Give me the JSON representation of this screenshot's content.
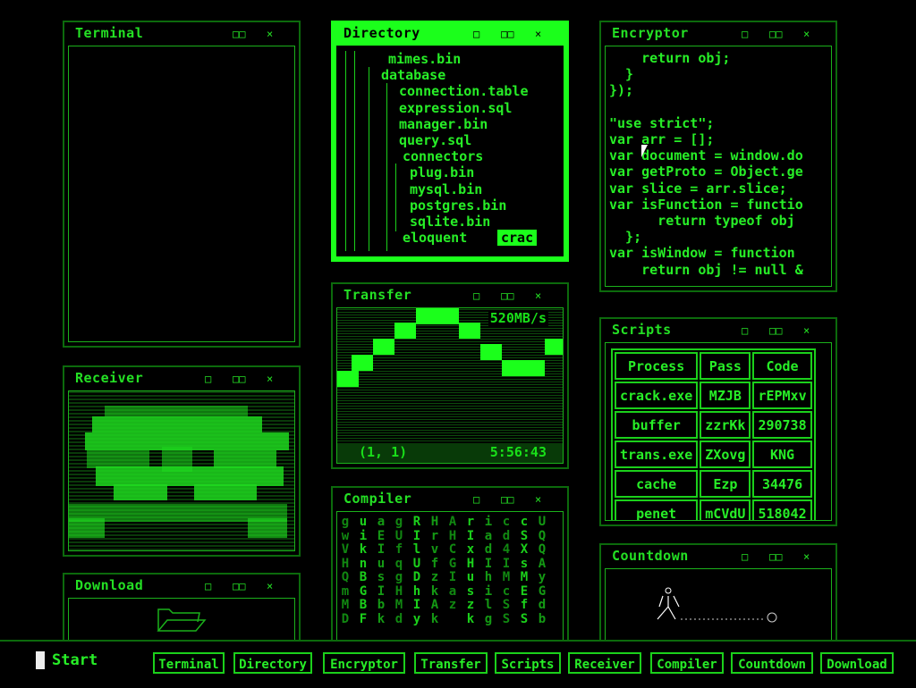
{
  "windows": {
    "terminal": {
      "title": "Terminal"
    },
    "directory": {
      "title": "Directory",
      "tree": [
        "mimes.bin",
        "database",
        "connection.table",
        "expression.sql",
        "manager.bin",
        "query.sql",
        "connectors",
        "plug.bin",
        "mysql.bin",
        "postgres.bin",
        "sqlite.bin",
        "eloquent"
      ],
      "highlight": "crac"
    },
    "encryptor": {
      "title": "Encryptor",
      "code": [
        "    return obj;",
        "  }",
        "});",
        "",
        "\"use strict\";",
        "var arr = [];",
        "var document = window.do",
        "var getProto = Object.ge",
        "var slice = arr.slice;",
        "var isFunction = functio",
        "      return typeof obj",
        "  };",
        "var isWindow = function",
        "    return obj != null &"
      ]
    },
    "transfer": {
      "title": "Transfer",
      "speed": "520MB/s",
      "coords": "(1, 1)",
      "time": "5:56:43"
    },
    "scripts": {
      "title": "Scripts",
      "headers": [
        "Process",
        "Pass",
        "Code"
      ],
      "rows": [
        [
          "crack.exe",
          "MZJB",
          "rEPMxv"
        ],
        [
          "buffer",
          "zzrKk",
          "290738"
        ],
        [
          "trans.exe",
          "ZXovg",
          "KNG"
        ],
        [
          "cache",
          "Ezp",
          "34476"
        ],
        [
          "penet",
          "mCVdU",
          "518042"
        ]
      ]
    },
    "receiver": {
      "title": "Receiver"
    },
    "compiler": {
      "title": "Compiler",
      "columns": [
        "gwVHQmMD",
        "uiknBGBF",
        "aEIusIbk",
        "gUfqgHMd",
        "RIlUDhIy",
        "HrvfzkAk",
        "AHCGIaz",
        "rIxHuszk",
        "iadIhilg",
        "cd4IMcSS",
        "cSXsMEfS",
        "UQQAyGdb"
      ]
    },
    "download": {
      "title": "Download"
    },
    "countdown": {
      "title": "Countdown"
    }
  },
  "controls": {
    "min": "□",
    "max": "□□",
    "close": "×"
  },
  "taskbar": {
    "start": "Start",
    "buttons": [
      "Terminal",
      "Directory",
      "Encryptor",
      "Transfer",
      "Scripts",
      "Receiver",
      "Compiler",
      "Countdown",
      "Download"
    ]
  }
}
